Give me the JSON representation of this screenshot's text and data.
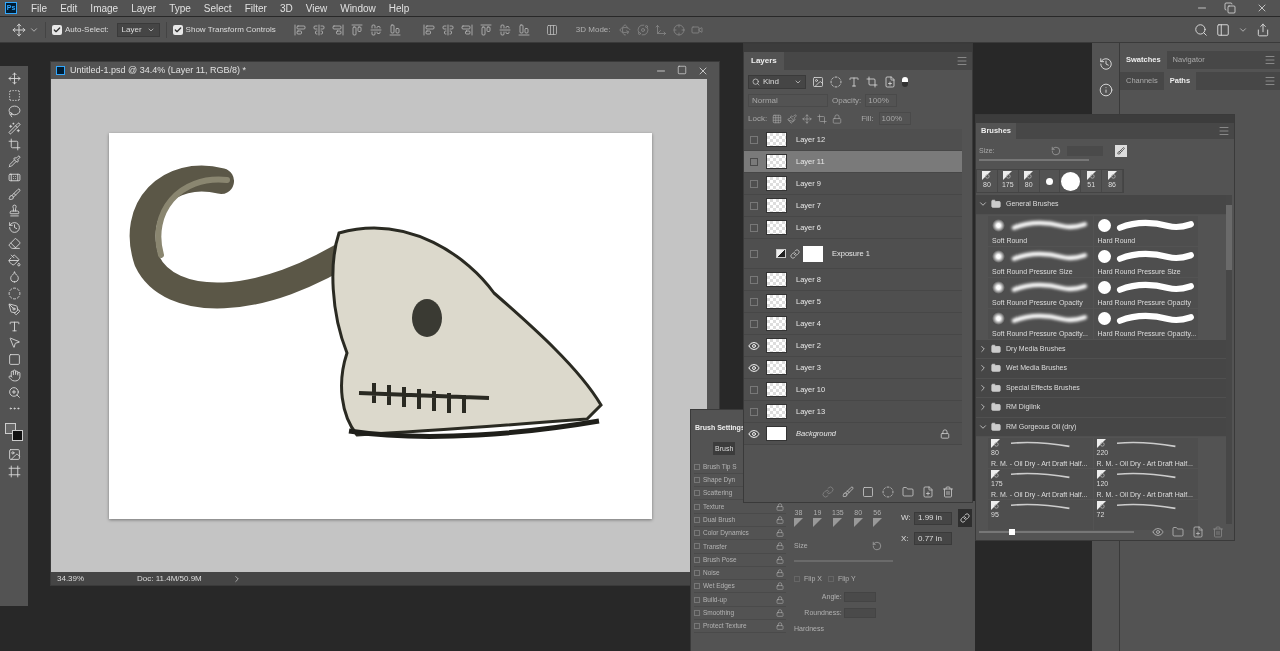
{
  "app": {
    "logo": "Ps",
    "menu": [
      "File",
      "Edit",
      "Image",
      "Layer",
      "Type",
      "Select",
      "Filter",
      "3D",
      "View",
      "Window",
      "Help"
    ]
  },
  "options_bar": {
    "auto_select": {
      "label": "Auto-Select:",
      "checked": true
    },
    "target": "Layer",
    "show_transform": {
      "label": "Show Transform Controls",
      "checked": true
    },
    "mode_label": "3D Mode:"
  },
  "document": {
    "title": "Untitled-1.psd @ 34.4% (Layer 11, RGB/8) *",
    "zoom": "34.39%",
    "doc_info": "Doc: 11.4M/50.9M"
  },
  "layers_panel": {
    "tab": "Layers",
    "filter": "Kind",
    "blend_mode": "Normal",
    "opacity_label": "Opacity:",
    "opacity": "100%",
    "lock_label": "Lock:",
    "fill_label": "Fill:",
    "fill": "100%",
    "layers": [
      {
        "name": "Layer 12",
        "kind": "pixel",
        "visible": false,
        "selected": false,
        "locked": false
      },
      {
        "name": "Layer 11",
        "kind": "pixel",
        "visible": false,
        "selected": true,
        "locked": false
      },
      {
        "name": "Layer 9",
        "kind": "pixel",
        "visible": false,
        "selected": false,
        "locked": false
      },
      {
        "name": "Layer 7",
        "kind": "pixel",
        "visible": false,
        "selected": false,
        "locked": false
      },
      {
        "name": "Layer 6",
        "kind": "pixel",
        "visible": false,
        "selected": false,
        "locked": false
      },
      {
        "name": "Exposure 1",
        "kind": "adjustment",
        "visible": false,
        "selected": false,
        "locked": false
      },
      {
        "name": "Layer 8",
        "kind": "pixel",
        "visible": false,
        "selected": false,
        "locked": false
      },
      {
        "name": "Layer 5",
        "kind": "pixel",
        "visible": false,
        "selected": false,
        "locked": false
      },
      {
        "name": "Layer 4",
        "kind": "pixel",
        "visible": false,
        "selected": false,
        "locked": false
      },
      {
        "name": "Layer 2",
        "kind": "pixel",
        "visible": true,
        "selected": false,
        "locked": false
      },
      {
        "name": "Layer 3",
        "kind": "pixel",
        "visible": true,
        "selected": false,
        "locked": false
      },
      {
        "name": "Layer 10",
        "kind": "pixel",
        "visible": false,
        "selected": false,
        "locked": false
      },
      {
        "name": "Layer 13",
        "kind": "pixel",
        "visible": false,
        "selected": false,
        "locked": false
      },
      {
        "name": "Background",
        "kind": "background",
        "visible": true,
        "selected": false,
        "locked": true
      }
    ]
  },
  "brush_settings": {
    "title": "Brush Settings",
    "button": "Brush",
    "options": [
      {
        "name": "Brush Tip S",
        "locked": false
      },
      {
        "name": "Shape Dyn",
        "locked": false
      },
      {
        "name": "Scattering",
        "locked": false
      },
      {
        "name": "Texture",
        "locked": true
      },
      {
        "name": "Dual Brush",
        "locked": true
      },
      {
        "name": "Color Dynamics",
        "locked": true
      },
      {
        "name": "Transfer",
        "locked": true
      },
      {
        "name": "Brush Pose",
        "locked": true
      },
      {
        "name": "Noise",
        "locked": true
      },
      {
        "name": "Wet Edges",
        "locked": true
      },
      {
        "name": "Build-up",
        "locked": true
      },
      {
        "name": "Smoothing",
        "locked": true
      },
      {
        "name": "Protect Texture",
        "locked": true
      }
    ],
    "tip_sizes": [
      "38",
      "19",
      "135",
      "80",
      "56"
    ],
    "size_label": "Size",
    "flip_x": "Flip X",
    "flip_y": "Flip Y",
    "angle_label": "Angle:",
    "roundness_label": "Roundness:",
    "hardness_label": "Hardness"
  },
  "properties": {
    "fields": [
      {
        "label": "W:",
        "value": "1.99 in"
      },
      {
        "label": "X:",
        "value": "0.77 in"
      }
    ]
  },
  "right_dock": {
    "tabs_top": [
      {
        "label": "Swatches",
        "selected": true
      },
      {
        "label": "Navigator",
        "selected": false
      }
    ],
    "tabs_bottom": [
      {
        "label": "Channels",
        "selected": false
      },
      {
        "label": "Paths",
        "selected": true
      }
    ]
  },
  "brushes_panel": {
    "tab": "Brushes",
    "size_label": "Size:",
    "preview_size": {
      "level": 0.2
    },
    "recent": [
      {
        "kind": "tip",
        "size": "80"
      },
      {
        "kind": "tip",
        "size": "175"
      },
      {
        "kind": "tip",
        "size": "80"
      },
      {
        "kind": "small_dot"
      },
      {
        "kind": "large_dot"
      },
      {
        "kind": "tip",
        "size": "51"
      },
      {
        "kind": "tip",
        "size": "86"
      }
    ],
    "groups": [
      {
        "name": "General Brushes",
        "expanded": true,
        "brushes": [
          {
            "kind": "soft",
            "name": "Soft Round"
          },
          {
            "kind": "hard",
            "name": "Hard Round"
          },
          {
            "kind": "soft",
            "name": "Soft Round Pressure Size"
          },
          {
            "kind": "hard",
            "name": "Hard Round Pressure Size"
          },
          {
            "kind": "soft",
            "name": "Soft Round Pressure Opacity"
          },
          {
            "kind": "hard",
            "name": "Hard Round Pressure Opacity"
          },
          {
            "kind": "soft",
            "name": "Soft Round Pressure Opacity..."
          },
          {
            "kind": "hard",
            "name": "Hard Round Pressure Opacity..."
          }
        ]
      },
      {
        "name": "Dry Media Brushes",
        "expanded": false
      },
      {
        "name": "Wet Media Brushes",
        "expanded": false
      },
      {
        "name": "Special Effects Brushes",
        "expanded": false
      },
      {
        "name": "RM DigiInk",
        "expanded": false
      },
      {
        "name": "RM Gorgeous Oil (dry)",
        "expanded": true,
        "brushes": [
          {
            "kind": "tip",
            "size": "80",
            "name": "R. M. - Oil Dry - Art Draft Half..."
          },
          {
            "kind": "tip",
            "size": "220",
            "name": "R. M. - Oil Dry - Art Draft Half..."
          },
          {
            "kind": "tip",
            "size": "175",
            "name": "R. M. - Oil Dry - Art Draft Half..."
          },
          {
            "kind": "tip",
            "size": "120",
            "name": "R. M. - Oil Dry - Art Draft Half..."
          },
          {
            "kind": "tip",
            "size": "95"
          },
          {
            "kind": "tip",
            "size": "72"
          }
        ]
      }
    ]
  }
}
